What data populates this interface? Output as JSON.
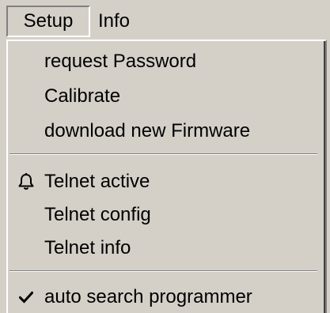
{
  "menubar": {
    "items": [
      {
        "label": "Setup",
        "state": "open"
      },
      {
        "label": "Info",
        "state": "closed"
      }
    ]
  },
  "dropdown": {
    "groups": [
      [
        {
          "label": "request Password"
        },
        {
          "label": "Calibrate"
        },
        {
          "label": "download new Firmware"
        }
      ],
      [
        {
          "label": "Telnet active",
          "icon": "bell-icon"
        },
        {
          "label": "Telnet config"
        },
        {
          "label": "Telnet info"
        }
      ],
      [
        {
          "label": "auto search programmer",
          "checked": true
        }
      ]
    ]
  },
  "colors": {
    "background": "#d4d0c8",
    "shadow": "#808080",
    "highlight": "#ffffff"
  }
}
